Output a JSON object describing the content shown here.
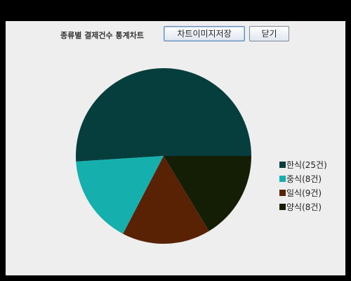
{
  "toolbar": {
    "title": "종류별 결제건수 통계차트",
    "save_label": "차트이미지저장",
    "close_label": "닫기"
  },
  "chart_data": {
    "type": "pie",
    "title": "",
    "categories": [
      "한식",
      "중식",
      "일식",
      "양식"
    ],
    "values": [
      25,
      8,
      8,
      8
    ],
    "colors": [
      "#063e3e",
      "#15b0ad",
      "#5a2205",
      "#131e05"
    ],
    "start_angle_deg": 0,
    "direction": "clockwise",
    "legend_position": "right",
    "legend_labels": [
      "한식(25건)",
      "중식(8건)",
      "일식(9건)",
      "양식(8건)"
    ]
  }
}
